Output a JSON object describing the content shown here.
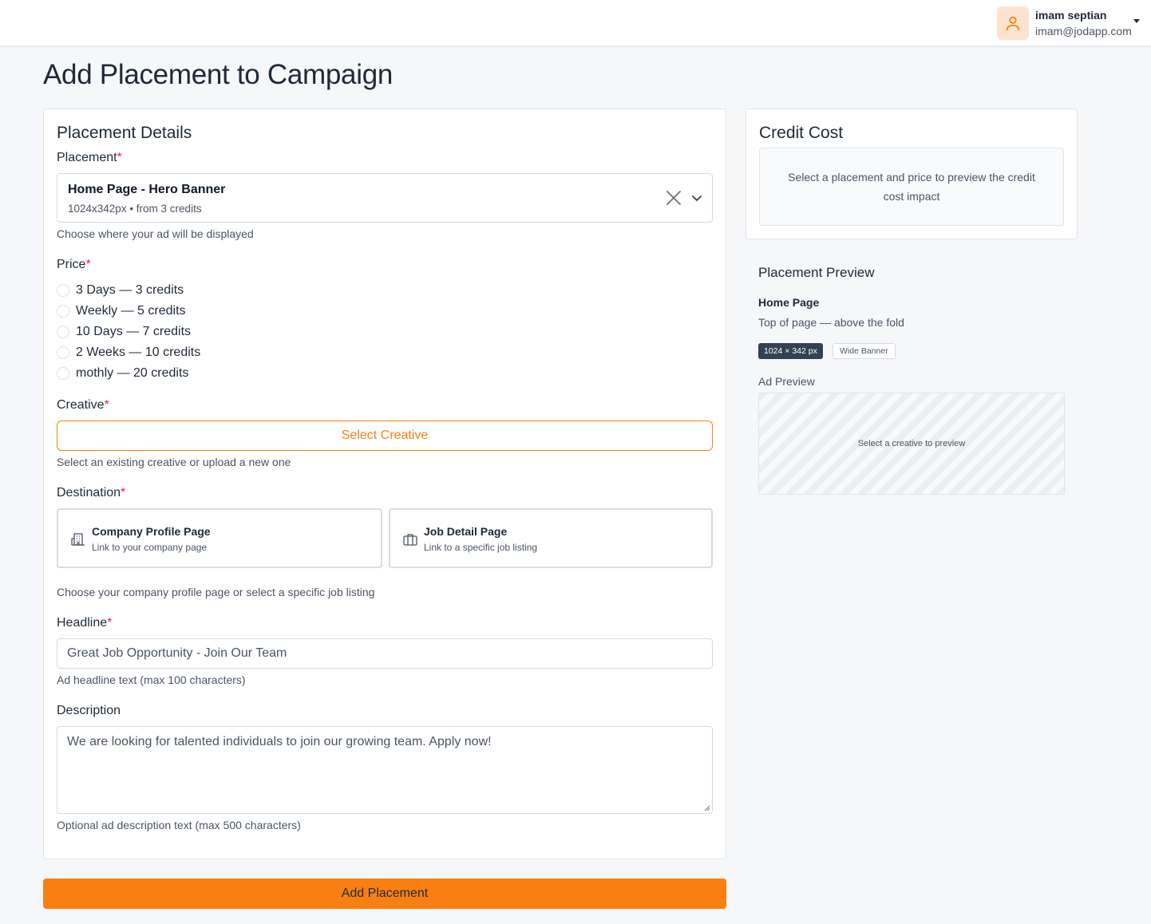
{
  "header": {
    "user_name": "imam septian",
    "user_email": "imam@jodapp.com"
  },
  "page": {
    "title": "Add Placement to Campaign"
  },
  "form": {
    "section_title": "Placement Details",
    "placement": {
      "label": "Placement",
      "required_mark": "*",
      "selected_title": "Home Page - Hero Banner",
      "selected_sub": "1024x342px • from 3 credits",
      "help": "Choose where your ad will be displayed"
    },
    "price": {
      "label": "Price",
      "required_mark": "*",
      "options": [
        {
          "label": "3 Days — 3 credits",
          "selected": false
        },
        {
          "label": "Weekly — 5 credits",
          "selected": false
        },
        {
          "label": "10 Days — 7 credits",
          "selected": false
        },
        {
          "label": "2 Weeks — 10 credits",
          "selected": false
        },
        {
          "label": "mothly — 20 credits",
          "selected": false
        }
      ]
    },
    "creative": {
      "label": "Creative",
      "required_mark": "*",
      "button": "Select Creative",
      "help": "Select an existing creative or upload a new one"
    },
    "destination": {
      "label": "Destination",
      "required_mark": "*",
      "options": [
        {
          "title": "Company Profile Page",
          "sub": "Link to your company page",
          "icon": "building-icon"
        },
        {
          "title": "Job Detail Page",
          "sub": "Link to a specific job listing",
          "icon": "briefcase-icon"
        }
      ],
      "help": "Choose your company profile page or select a specific job listing"
    },
    "headline": {
      "label": "Headline",
      "required_mark": "*",
      "value": "Great Job Opportunity - Join Our Team",
      "help": "Ad headline text (max 100 characters)"
    },
    "description": {
      "label": "Description",
      "value": "We are looking for talented individuals to join our growing team. Apply now!",
      "help": "Optional ad description text (max 500 characters)"
    },
    "submit": "Add Placement"
  },
  "credit_cost": {
    "title": "Credit Cost",
    "message": "Select a placement and price to preview the credit cost impact"
  },
  "placement_preview": {
    "title": "Placement Preview",
    "page": "Home Page",
    "position": "Top of page — above the fold",
    "size_badge": "1024 × 342 px",
    "type_badge": "Wide Banner",
    "ad_label": "Ad Preview",
    "ad_placeholder": "Select a creative to preview"
  },
  "colors": {
    "accent": "#f97f12",
    "required": "#e11d48",
    "dark_badge": "#334155"
  }
}
